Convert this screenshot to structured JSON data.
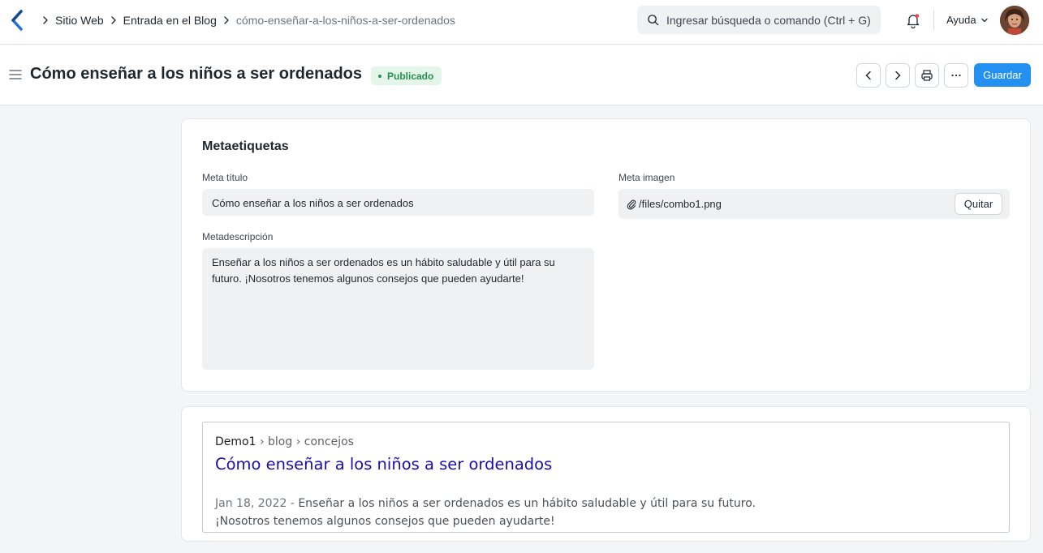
{
  "navbar": {
    "breadcrumbs": [
      "Sitio Web",
      "Entrada en el Blog",
      "cómo-enseñar-a-los-niños-a-ser-ordenados"
    ],
    "search_placeholder": "Ingresar búsqueda o comando (Ctrl + G)",
    "help_label": "Ayuda"
  },
  "header": {
    "title": "Cómo enseñar a los niños a ser ordenados",
    "status": "Publicado",
    "status_color": "#278f4f",
    "save_label": "Guardar"
  },
  "meta": {
    "section_title": "Metaetiquetas",
    "meta_title_label": "Meta título",
    "meta_title_value": "Cómo enseñar a los niños a ser ordenados",
    "meta_desc_label": "Metadescripción",
    "meta_desc_value": "Enseñar a los niños a ser ordenados es un hábito saludable y útil para su futuro. ¡Nosotros tenemos algunos consejos que pueden ayudarte!",
    "meta_image_label": "Meta imagen",
    "meta_image_value": "/files/combo1.png",
    "remove_label": "Quitar"
  },
  "preview": {
    "site": "Demo1",
    "path": " › blog › concejos",
    "title": "Cómo enseñar a los niños a ser ordenados",
    "date": "Jan 18, 2022 - ",
    "desc_line1": "Enseñar a los niños a ser ordenados es un hábito saludable y útil para su futuro.",
    "desc_line2": "¡Nosotros tenemos algunos consejos que pueden ayudarte!"
  },
  "colors": {
    "accent": "#2490ef",
    "link": "#1a0dab"
  }
}
